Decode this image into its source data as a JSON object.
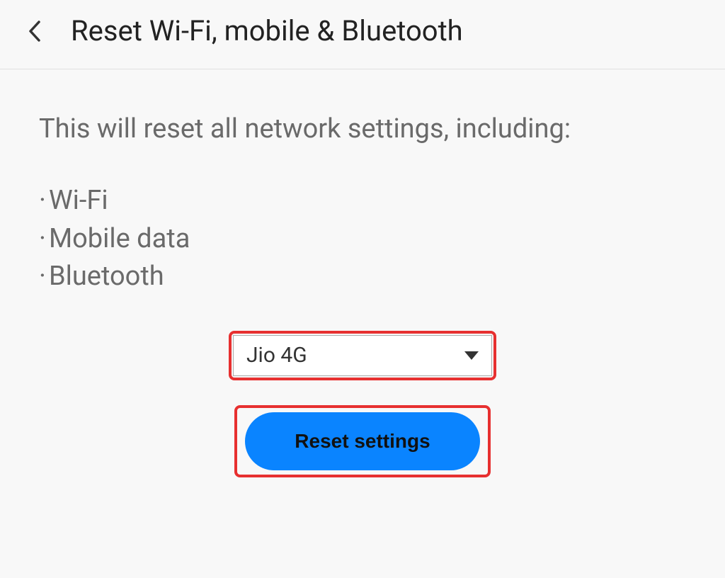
{
  "header": {
    "title": "Reset Wi-Fi, mobile & Bluetooth"
  },
  "content": {
    "description": "This will reset all network settings, including:",
    "bullets": {
      "wifi": "Wi-Fi",
      "mobile_data": "Mobile data",
      "bluetooth": "Bluetooth"
    }
  },
  "dropdown": {
    "selected": "Jio 4G"
  },
  "button": {
    "reset_label": "Reset settings"
  }
}
